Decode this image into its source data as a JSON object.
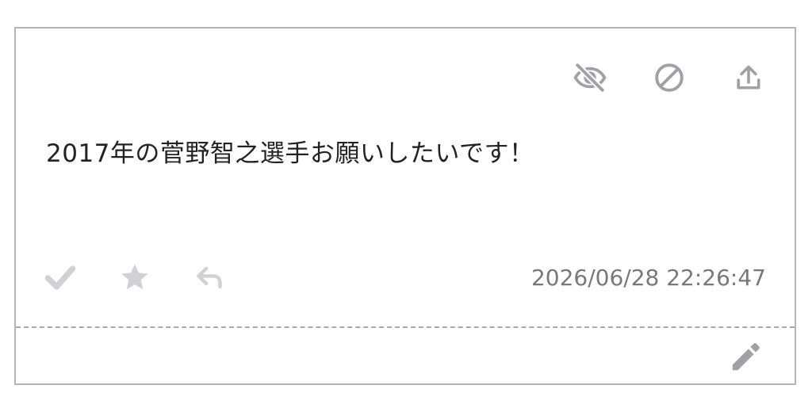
{
  "message": {
    "text": "2017年の菅野智之選手お願いしたいです！",
    "timestamp": "2026/06/28 22:26:47"
  },
  "icons": {
    "top": [
      "eye-off-icon",
      "block-icon",
      "share-icon"
    ],
    "bottom": [
      "check-icon",
      "star-icon",
      "reply-icon"
    ],
    "footer": [
      "pencil-icon"
    ]
  },
  "colors": {
    "icon_dark": "#a0a0a6",
    "icon_light": "#d0d0d5",
    "border": "#b4b4bb",
    "text": "#222222",
    "timestamp": "#77777d"
  }
}
